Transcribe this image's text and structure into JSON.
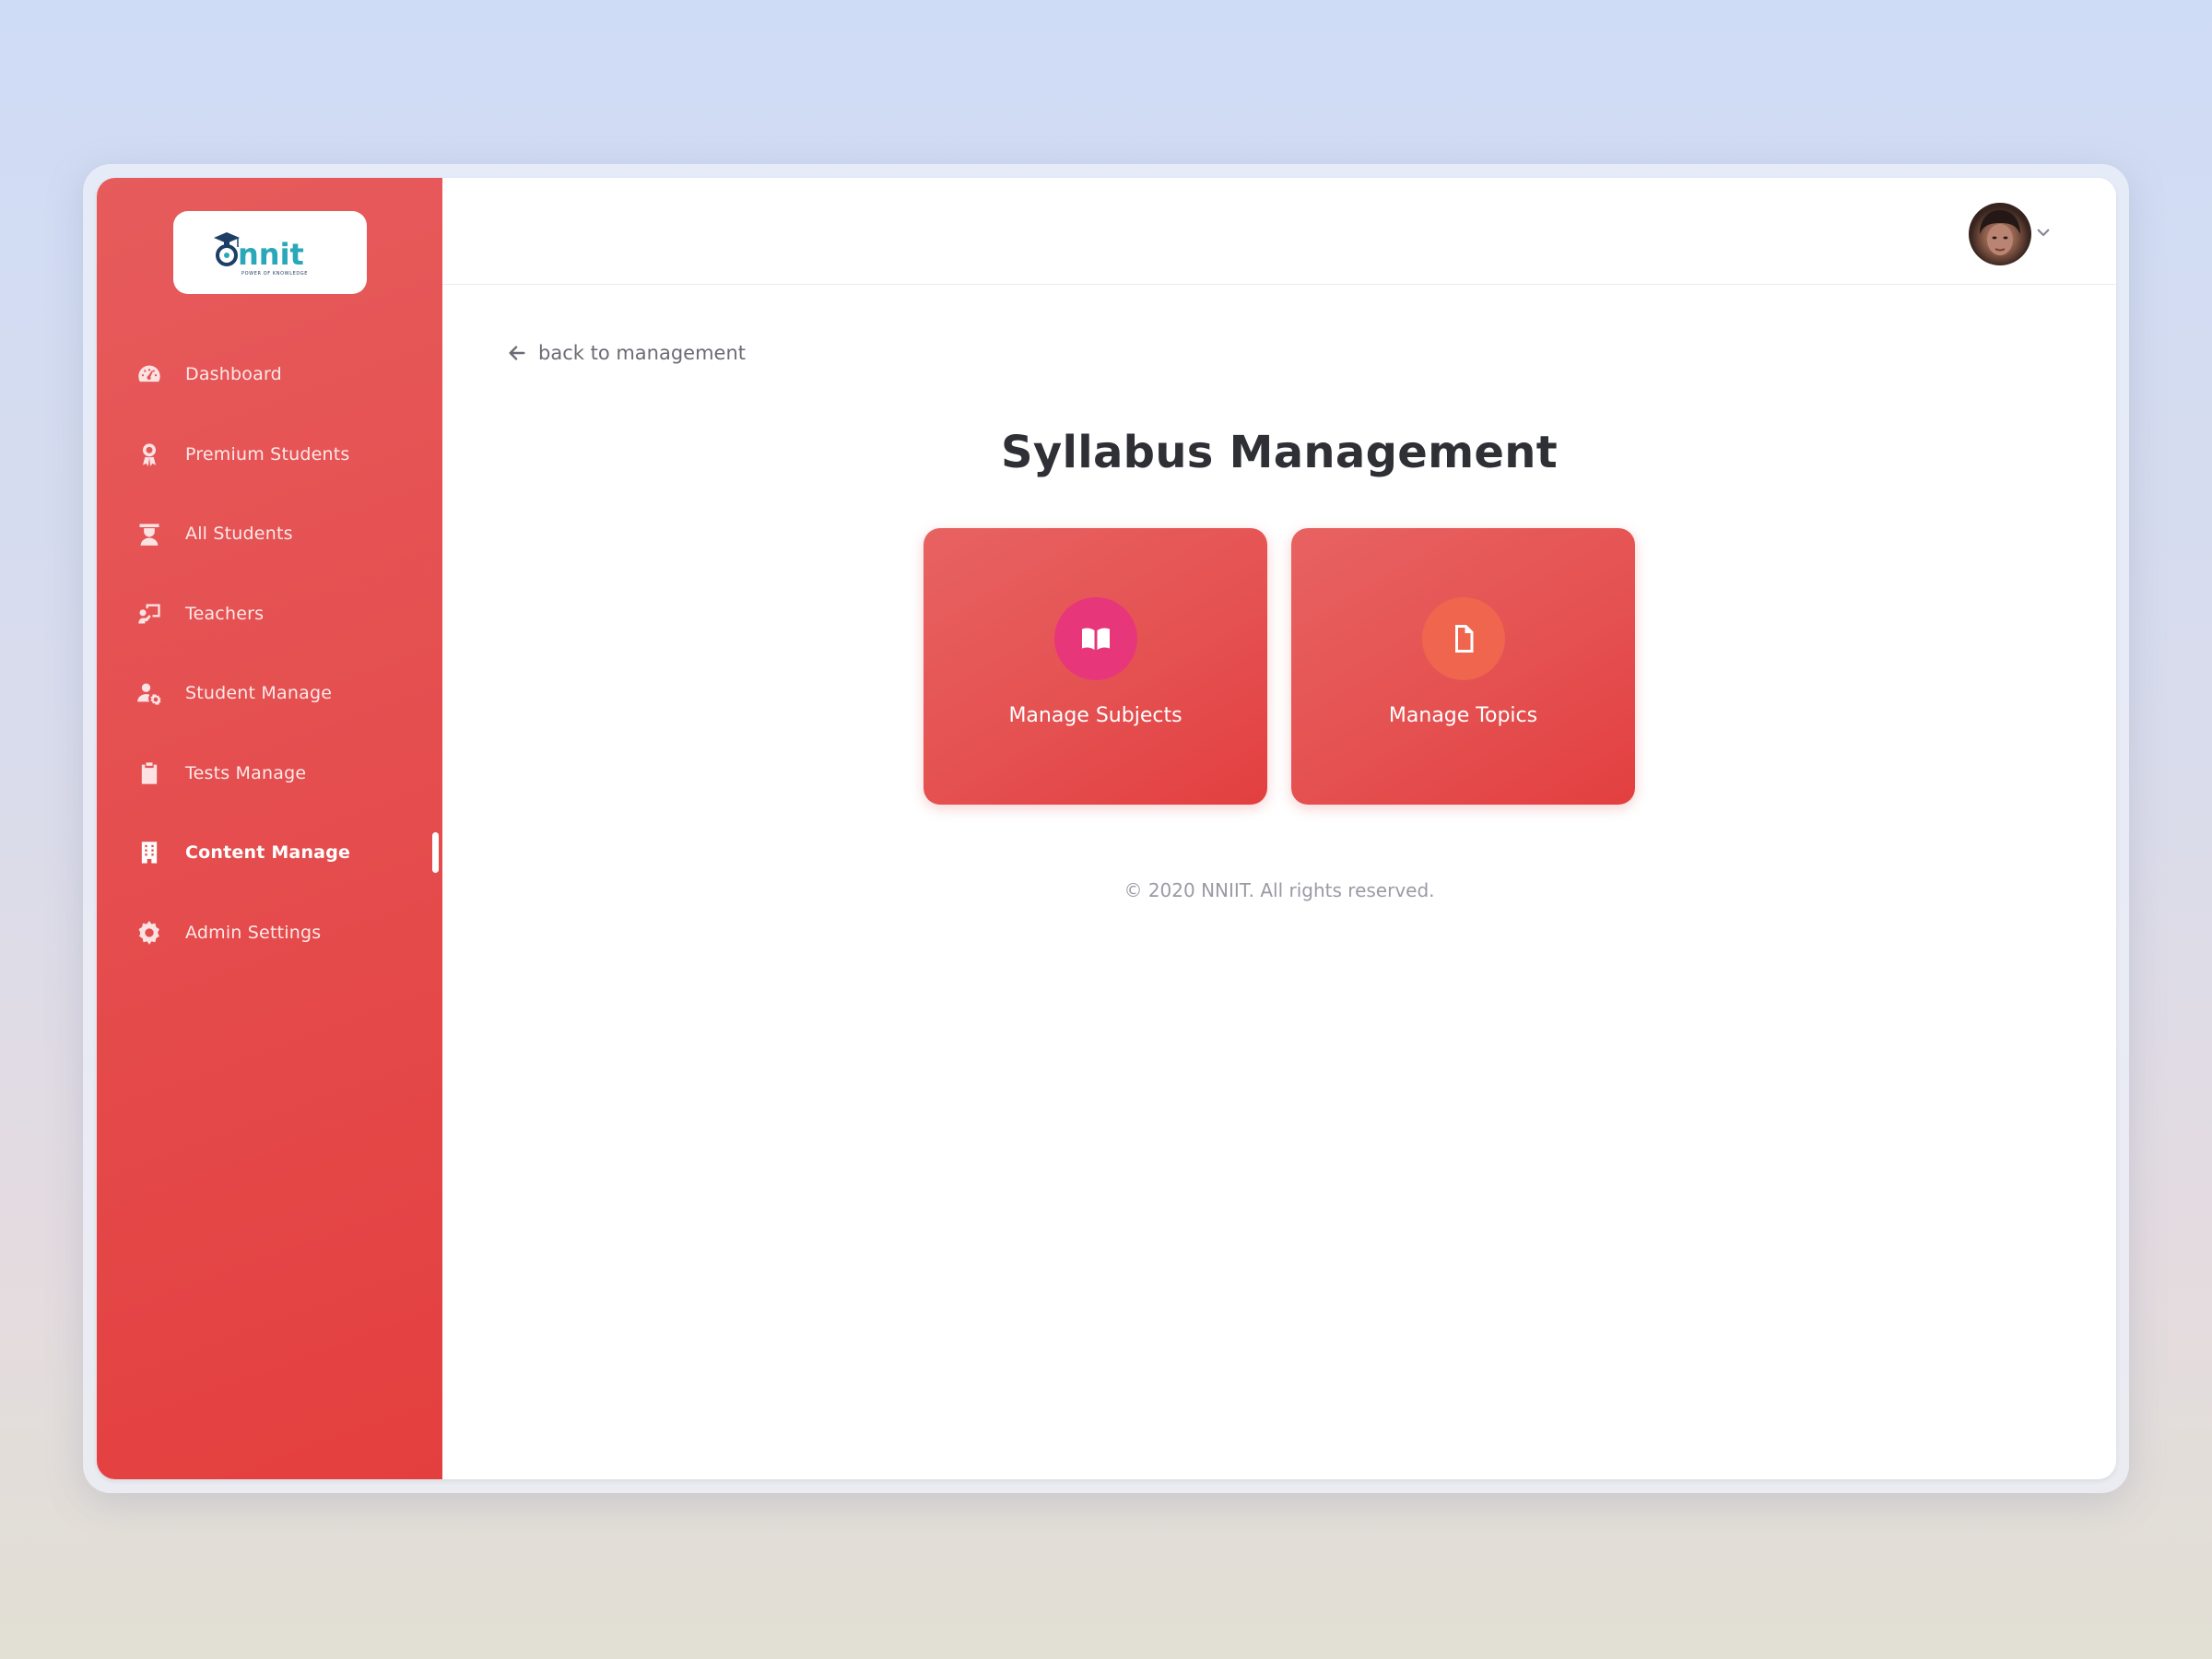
{
  "brand": {
    "logo_text": "nnit",
    "logo_tagline": "POWER OF KNOWLEDGE"
  },
  "sidebar": {
    "items": [
      {
        "label": "Dashboard",
        "icon": "dashboard-gauge-icon"
      },
      {
        "label": "Premium Students",
        "icon": "award-icon"
      },
      {
        "label": "All Students",
        "icon": "graduate-icon"
      },
      {
        "label": "Teachers",
        "icon": "teacher-board-icon"
      },
      {
        "label": "Student Manage",
        "icon": "user-cog-icon"
      },
      {
        "label": "Tests Manage",
        "icon": "clipboard-icon"
      },
      {
        "label": "Content Manage",
        "icon": "building-icon",
        "active": true
      },
      {
        "label": "Admin Settings",
        "icon": "gear-icon"
      }
    ]
  },
  "header": {
    "avatar": "user-avatar",
    "menu_icon": "chevron-down-icon"
  },
  "main": {
    "back_link": "back to management",
    "title": "Syllabus Management",
    "cards": [
      {
        "label": "Manage Subjects",
        "icon": "book-open-icon",
        "icon_bg": "#e8367a"
      },
      {
        "label": "Manage Topics",
        "icon": "file-icon",
        "icon_bg": "#f0654d"
      }
    ],
    "footer": "© 2020 NNIIT. All rights reserved."
  },
  "colors": {
    "sidebar": "#e54d4e",
    "accent": "#e43f3f",
    "title": "#2f2f36"
  }
}
